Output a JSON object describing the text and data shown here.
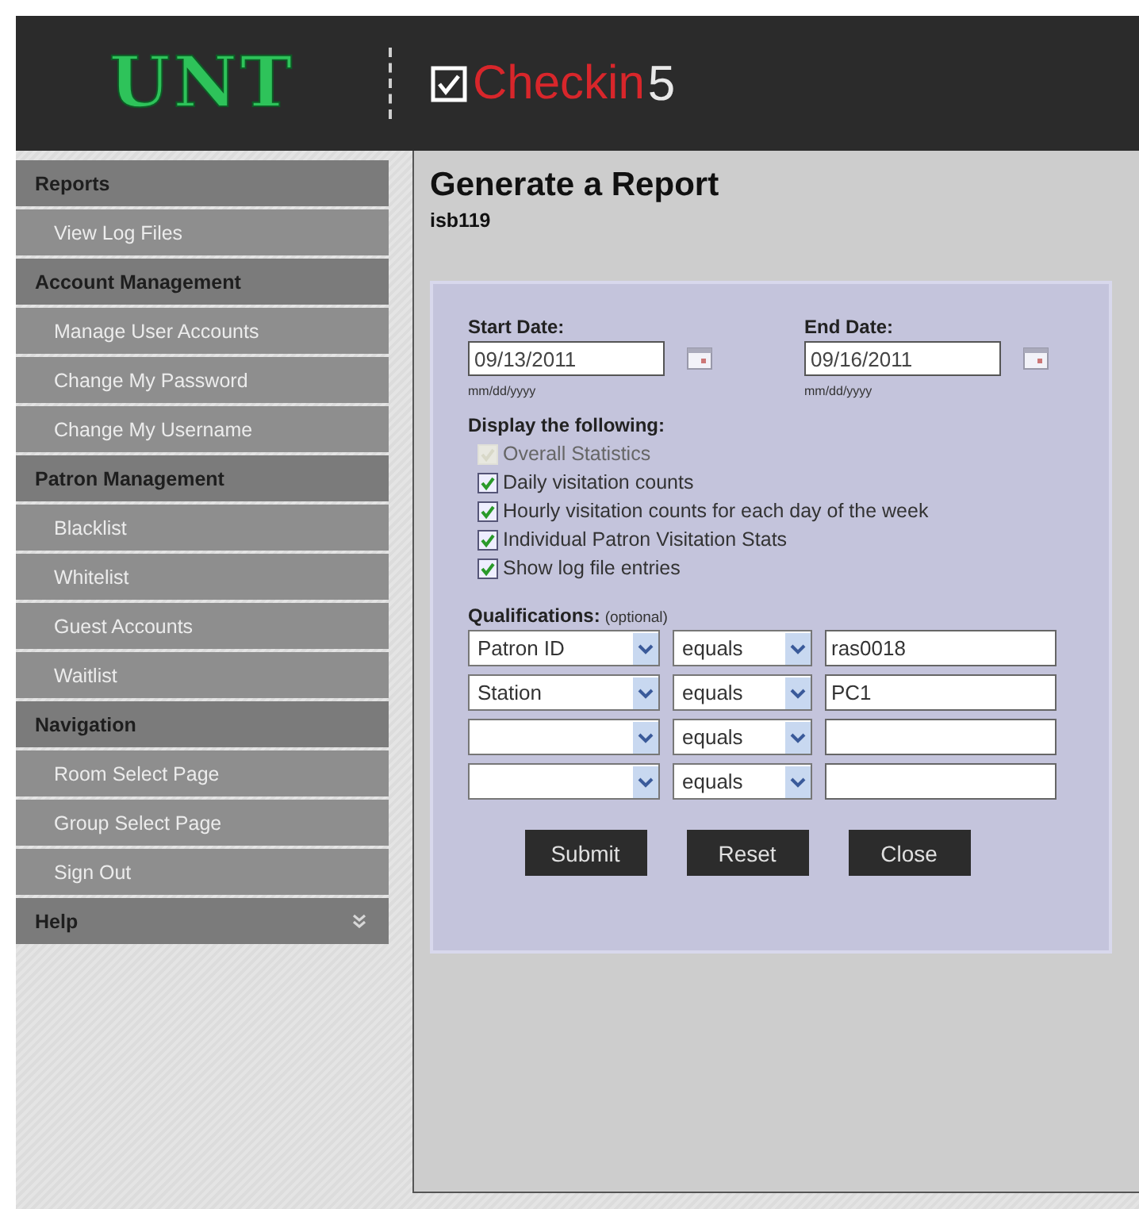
{
  "header": {
    "logo": "UNT",
    "app_name": "Checkin",
    "app_version": "5"
  },
  "sidebar": {
    "items": [
      {
        "kind": "header",
        "label": "Reports"
      },
      {
        "kind": "link",
        "label": "View Log Files"
      },
      {
        "kind": "header",
        "label": "Account Management"
      },
      {
        "kind": "link",
        "label": "Manage User Accounts"
      },
      {
        "kind": "link",
        "label": "Change My Password"
      },
      {
        "kind": "link",
        "label": "Change My Username"
      },
      {
        "kind": "header",
        "label": "Patron Management"
      },
      {
        "kind": "link",
        "label": "Blacklist"
      },
      {
        "kind": "link",
        "label": "Whitelist"
      },
      {
        "kind": "link",
        "label": "Guest Accounts"
      },
      {
        "kind": "link",
        "label": "Waitlist"
      },
      {
        "kind": "header",
        "label": "Navigation"
      },
      {
        "kind": "link",
        "label": "Room Select Page"
      },
      {
        "kind": "link",
        "label": "Group Select Page"
      },
      {
        "kind": "link",
        "label": "Sign Out"
      },
      {
        "kind": "header",
        "label": "Help",
        "collapsible": true
      }
    ]
  },
  "page": {
    "title": "Generate a Report",
    "subtitle": "isb119"
  },
  "form": {
    "start_date": {
      "label": "Start Date:",
      "value": "09/13/2011",
      "hint": "mm/dd/yyyy"
    },
    "end_date": {
      "label": "End Date:",
      "value": "09/16/2011",
      "hint": "mm/dd/yyyy"
    },
    "display_label": "Display the following:",
    "options": [
      {
        "label": "Overall Statistics",
        "checked": true,
        "disabled": true
      },
      {
        "label": "Daily visitation counts",
        "checked": true,
        "disabled": false
      },
      {
        "label": "Hourly visitation counts for each day of the week",
        "checked": true,
        "disabled": false
      },
      {
        "label": "Individual Patron Visitation Stats",
        "checked": true,
        "disabled": false
      },
      {
        "label": "Show log file entries",
        "checked": true,
        "disabled": false
      }
    ],
    "qualifications_label": "Qualifications:",
    "qualifications_note": "(optional)",
    "qualifications": [
      {
        "field": "Patron ID",
        "operator": "equals",
        "value": "ras0018"
      },
      {
        "field": "Station",
        "operator": "equals",
        "value": "PC1"
      },
      {
        "operator": "equals"
      },
      {
        "operator": "equals"
      }
    ],
    "buttons": [
      "Submit",
      "Reset",
      "Close"
    ]
  }
}
